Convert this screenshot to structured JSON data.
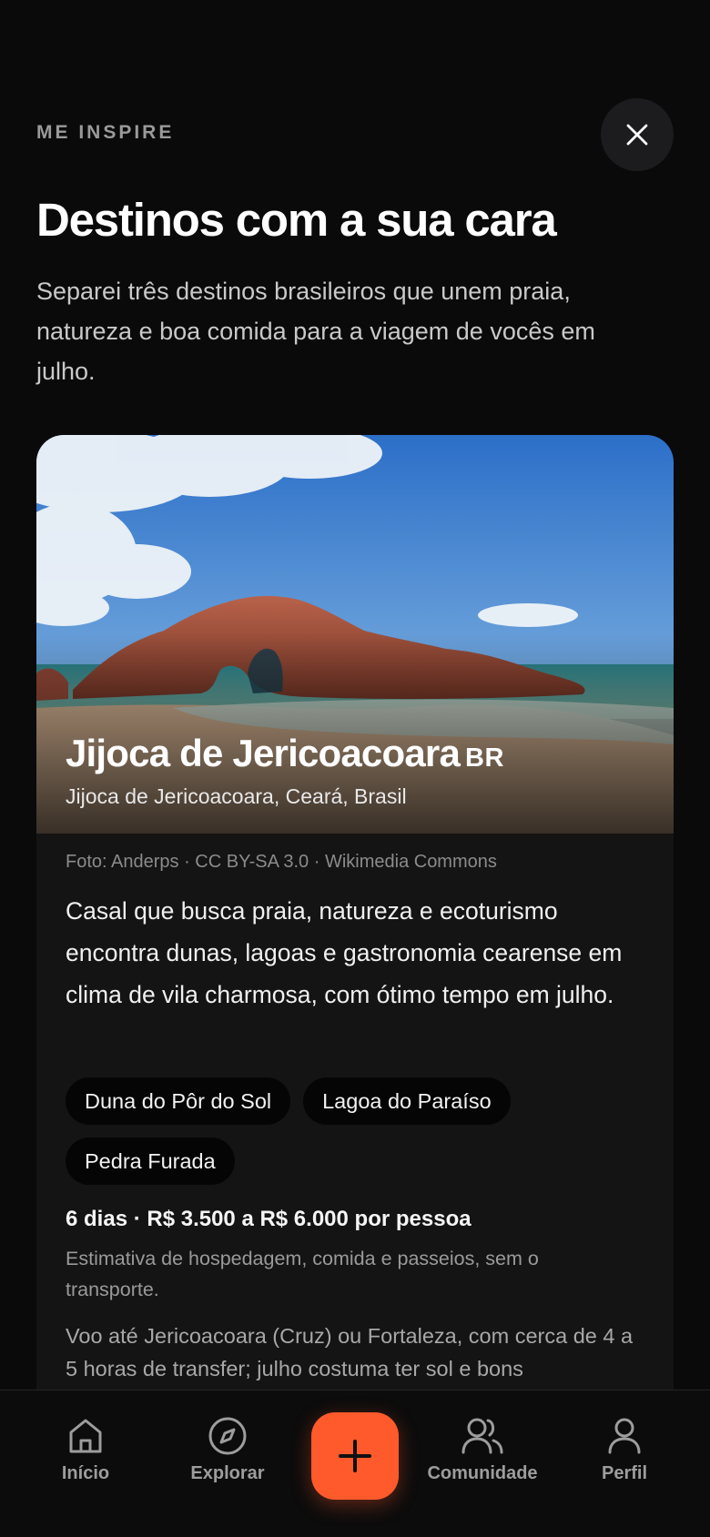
{
  "header": {
    "eyebrow": "ME INSPIRE",
    "close_icon": "close-icon",
    "title": "Destinos com a sua cara",
    "subtitle": "Separei três destinos brasileiros que unem praia, natureza e boa comida para a viagem de vocês em julho."
  },
  "card": {
    "name": "Jijoca de Jericoacoara",
    "country_code": "BR",
    "location": "Jijoca de Jericoacoara, Ceará, Brasil",
    "photo_credit": "Foto: Anderps · CC BY-SA 3.0 · Wikimedia Commons",
    "description": "Casal que busca praia, natureza e ecoturismo encontra dunas, lagoas e gastronomia cearense em clima de vila charmosa, com ótimo tempo em julho.",
    "highlights": [
      "Duna do Pôr do Sol",
      "Lagoa do Paraíso",
      "Pedra Furada"
    ],
    "price": "6 dias · R$ 3.500 a R$ 6.000 por pessoa",
    "estimate_note": "Estimativa de hospedagem, comida e passeios, sem o transporte.",
    "transfer_note": "Voo até Jericoacoara (Cruz) ou Fortaleza, com cerca de 4 a 5 horas de transfer; julho costuma ter sol e bons"
  },
  "tabbar": {
    "items": [
      {
        "label": "Início",
        "icon": "home-icon"
      },
      {
        "label": "Explorar",
        "icon": "compass-icon"
      },
      {
        "label": "Comunidade",
        "icon": "users-icon"
      },
      {
        "label": "Perfil",
        "icon": "user-icon"
      }
    ],
    "fab_icon": "plus-icon"
  },
  "colors": {
    "background": "#0a0a0b",
    "card": "#141414",
    "accent": "#ff5a2b"
  }
}
